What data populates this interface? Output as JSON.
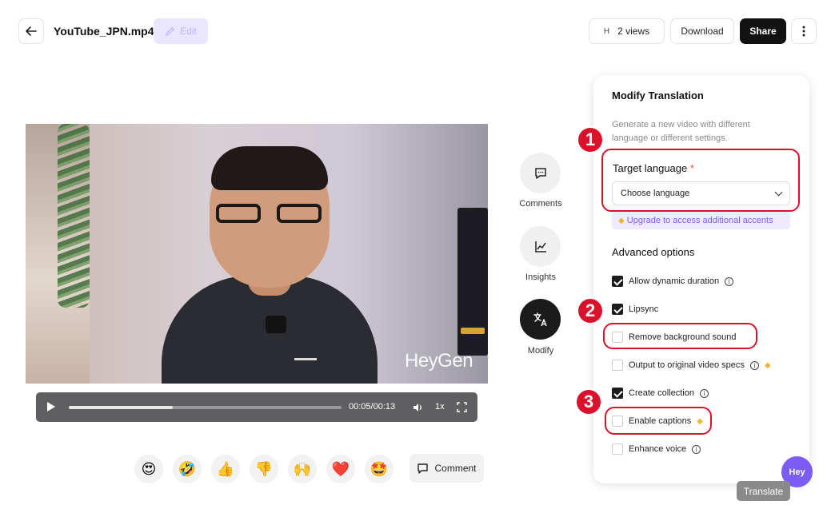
{
  "header": {
    "file_title": "YouTube_JPN.mp4",
    "edit_label": "Edit",
    "views_avatar": "H",
    "views_label": "2 views",
    "download_label": "Download",
    "share_label": "Share"
  },
  "video": {
    "watermark": "HeyGen"
  },
  "player": {
    "time": "00:05/00:13",
    "speed": "1x",
    "progress": 0.38
  },
  "reactions": {
    "items": [
      "😍",
      "🤣",
      "👍",
      "👎",
      "🙌",
      "❤️",
      "🤩"
    ],
    "comment_label": "Comment"
  },
  "rail": {
    "comments_label": "Comments",
    "insights_label": "Insights",
    "modify_label": "Modify"
  },
  "panel": {
    "title": "Modify Translation",
    "description": "Generate a new video with different language or different settings.",
    "target_language_label": "Target language",
    "required_marker": "*",
    "select_value": "Choose language",
    "upgrade_text": "Upgrade to access additional accents",
    "advanced_title": "Advanced options",
    "options": [
      {
        "label": "Allow dynamic duration",
        "checked": true
      },
      {
        "label": "Lipsync",
        "checked": true
      },
      {
        "label": "Remove background sound",
        "checked": false
      },
      {
        "label": "Output to original video specs",
        "checked": false
      },
      {
        "label": "Create collection",
        "checked": true
      },
      {
        "label": "Enable captions",
        "checked": false
      },
      {
        "label": "Enhance voice",
        "checked": false
      }
    ],
    "translate_label": "Translate"
  },
  "annotations": {
    "badge_1": "1",
    "badge_2": "2",
    "badge_3": "3",
    "color": "#d9112b"
  },
  "assistant": {
    "label": "Hey"
  },
  "colors": {
    "accent": "#7b5cf5",
    "dark_button": "#121212",
    "annotation": "#d9112b"
  }
}
